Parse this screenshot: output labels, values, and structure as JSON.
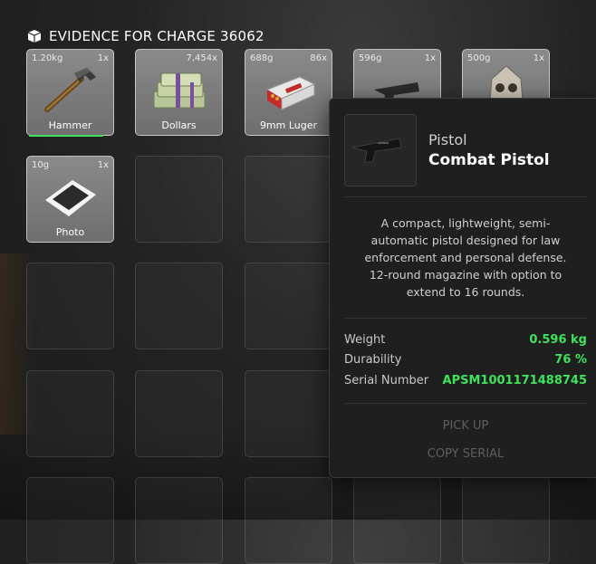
{
  "header": {
    "title": "EVIDENCE FOR CHARGE 36062"
  },
  "items": [
    {
      "name": "Hammer",
      "weight": "1.20kg",
      "qty": "1x",
      "icon": "hammer-icon",
      "durability": 1.0
    },
    {
      "name": "Dollars",
      "weight": "",
      "qty": "7,454x",
      "icon": "cash-stack-icon"
    },
    {
      "name": "9mm Luger",
      "weight": "688g",
      "qty": "86x",
      "icon": "ammo-box-icon"
    },
    {
      "name": "",
      "weight": "596g",
      "qty": "1x",
      "icon": "pistol-icon"
    },
    {
      "name": "",
      "weight": "500g",
      "qty": "1x",
      "icon": "mask-icon"
    },
    {
      "name": "Photo",
      "weight": "10g",
      "qty": "1x",
      "icon": "photo-icon"
    }
  ],
  "tooltip": {
    "category": "Pistol",
    "name": "Combat Pistol",
    "icon": "pistol-icon",
    "description": "A compact, lightweight, semi-automatic pistol designed for law enforcement and personal defense. 12-round magazine with option to extend to 16 rounds.",
    "stats": [
      {
        "label": "Weight",
        "value": "0.596 kg"
      },
      {
        "label": "Durability",
        "value": "76 %"
      },
      {
        "label": "Serial Number",
        "value": "APSM1001171488745"
      }
    ],
    "actions": {
      "pick_up": "PICK UP",
      "copy_serial": "COPY SERIAL"
    },
    "value_color": "#3fe35b"
  }
}
